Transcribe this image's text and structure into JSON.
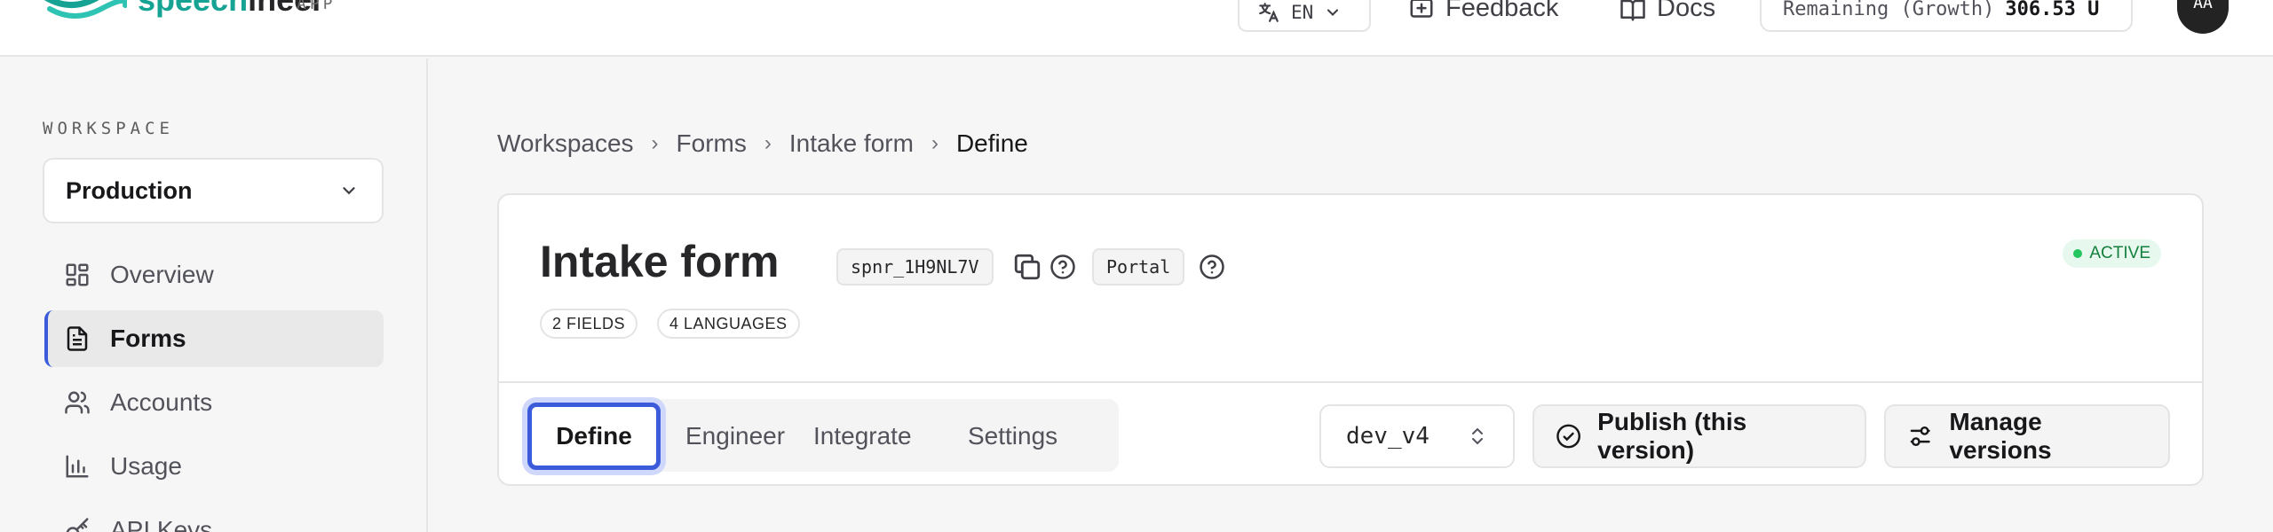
{
  "header": {
    "brand_prefix": "speech",
    "brand_suffix": "ineer",
    "brand_tag": "APP",
    "language": "EN",
    "feedback_label": "Feedback",
    "docs_label": "Docs",
    "remaining_label": "Remaining (Growth)",
    "remaining_amount": "306.53 U",
    "avatar_initials": "AA"
  },
  "sidebar": {
    "workspace_label": "WORKSPACE",
    "workspace_value": "Production",
    "items": [
      {
        "label": "Overview",
        "icon": "dashboard-icon"
      },
      {
        "label": "Forms",
        "icon": "document-icon",
        "active": true
      },
      {
        "label": "Accounts",
        "icon": "users-icon"
      },
      {
        "label": "Usage",
        "icon": "bar-chart-icon"
      },
      {
        "label": "API Keys",
        "icon": "key-icon"
      }
    ]
  },
  "breadcrumb": [
    "Workspaces",
    "Forms",
    "Intake form",
    "Define"
  ],
  "form": {
    "title": "Intake form",
    "id": "spnr_1H9NL7V",
    "portal_label": "Portal",
    "fields_badge": "2 FIELDS",
    "languages_badge": "4 LANGUAGES",
    "status": "ACTIVE"
  },
  "tabs": [
    "Define",
    "Engineer",
    "Integrate",
    "Settings"
  ],
  "version": "dev_v4",
  "actions": {
    "publish_label": "Publish (this version)",
    "manage_label": "Manage versions"
  },
  "colors": {
    "accent": "#3b5bdb",
    "brand_teal": "#16a394",
    "status_green": "#15803d"
  }
}
